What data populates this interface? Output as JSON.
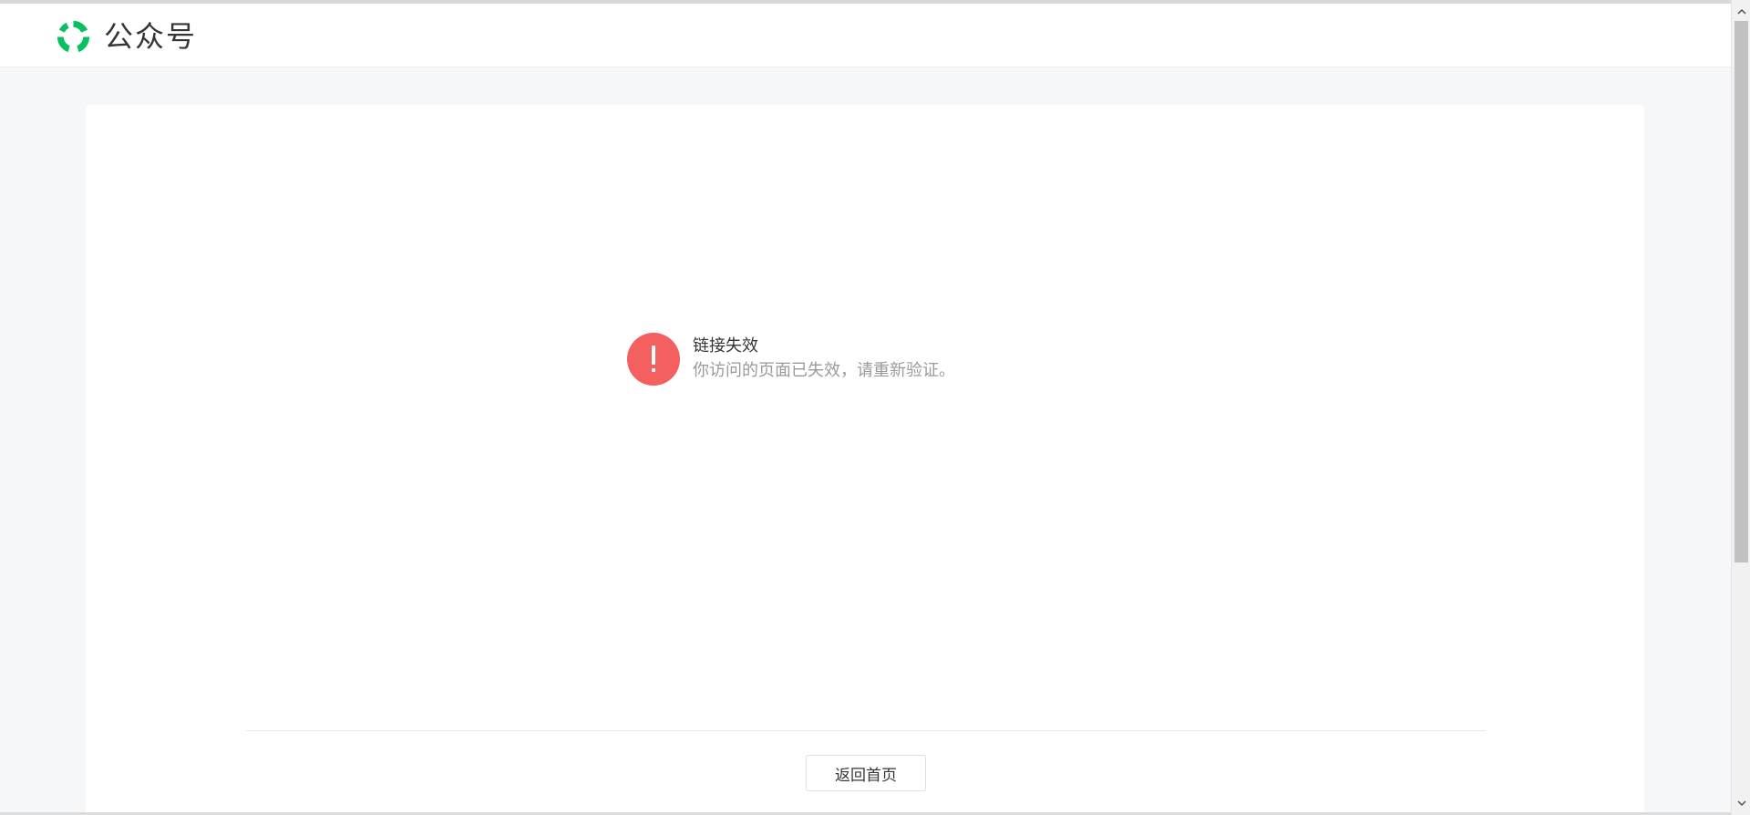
{
  "header": {
    "brand_name": "公众号",
    "brand_logo_icon": "wechat-official-account-logo-icon",
    "brand_color": "#07c160"
  },
  "message": {
    "icon": "exclamation-circle-icon",
    "icon_color": "#f45f5f",
    "title": "链接失效",
    "description": "你访问的页面已失效，请重新验证。"
  },
  "footer": {
    "home_button_label": "返回首页"
  },
  "scrollbar": {
    "up_icon": "chevron-up-icon",
    "down_icon": "chevron-down-icon"
  }
}
